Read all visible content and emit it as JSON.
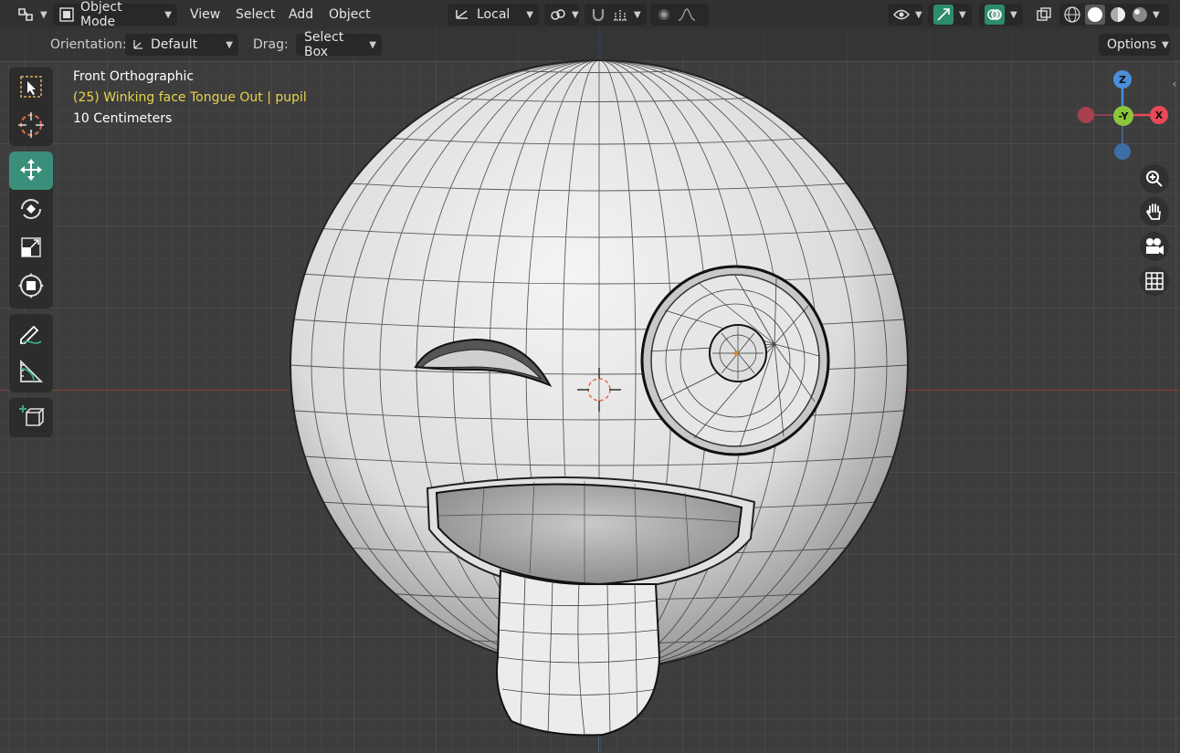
{
  "header": {
    "mode_label": "Object Mode",
    "menus": [
      "View",
      "Select",
      "Add",
      "Object"
    ],
    "transform_space": "Local",
    "options_label": "Options"
  },
  "subheader": {
    "orientation_label": "Orientation:",
    "orientation_value": "Default",
    "drag_label": "Drag:",
    "drag_value": "Select Box"
  },
  "overlay": {
    "view_name": "Front Orthographic",
    "object_info": "(25) Winking face Tongue Out | pupil",
    "scale": "10 Centimeters"
  },
  "gizmo": {
    "z": "Z",
    "y": "-Y",
    "x": "X"
  },
  "toolbar": {
    "tools": [
      "select-box",
      "cursor",
      "move",
      "rotate",
      "scale",
      "transform",
      "annotate",
      "measure",
      "add-cube"
    ],
    "active_tool": "move"
  },
  "colors": {
    "active_tool": "#3a8f7a",
    "axis_x": "#e8495a",
    "axis_y": "#8cc63e",
    "axis_z": "#4a8fd9",
    "overlay_yellow": "#e8d34a"
  }
}
